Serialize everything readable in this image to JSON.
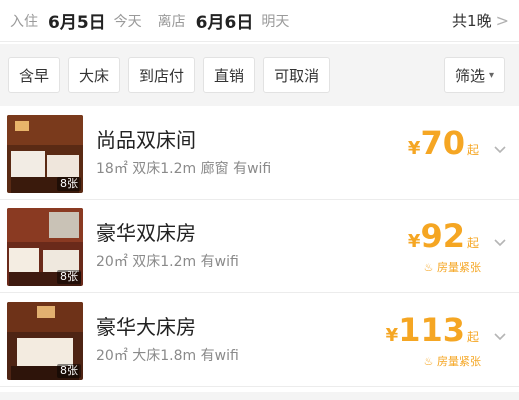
{
  "dates": {
    "checkin_label": "入住",
    "checkin_date": "6月5日",
    "checkin_rel": "今天",
    "checkout_label": "离店",
    "checkout_date": "6月6日",
    "checkout_rel": "明天",
    "nights": "共1晚"
  },
  "filters": {
    "chips": [
      "含早",
      "大床",
      "到店付",
      "直销",
      "可取消"
    ],
    "filter_label": "筛选"
  },
  "rooms": [
    {
      "name": "尚品双床间",
      "desc": "18㎡ 双床1.2m 廊窗 有wifi",
      "currency": "¥",
      "price": "70",
      "suffix": "起",
      "tag": "",
      "photo_count": "8张"
    },
    {
      "name": "豪华双床房",
      "desc": "20㎡ 双床1.2m 有wifi",
      "currency": "¥",
      "price": "92",
      "suffix": "起",
      "tag": "房量紧张",
      "photo_count": "8张"
    },
    {
      "name": "豪华大床房",
      "desc": "20㎡ 大床1.8m 有wifi",
      "currency": "¥",
      "price": "113",
      "suffix": "起",
      "tag": "房量紧张",
      "photo_count": "8张"
    }
  ],
  "colors": {
    "price": "#f5a623",
    "muted": "#9a9a9a",
    "filter_bg": "#f4f4f4"
  }
}
